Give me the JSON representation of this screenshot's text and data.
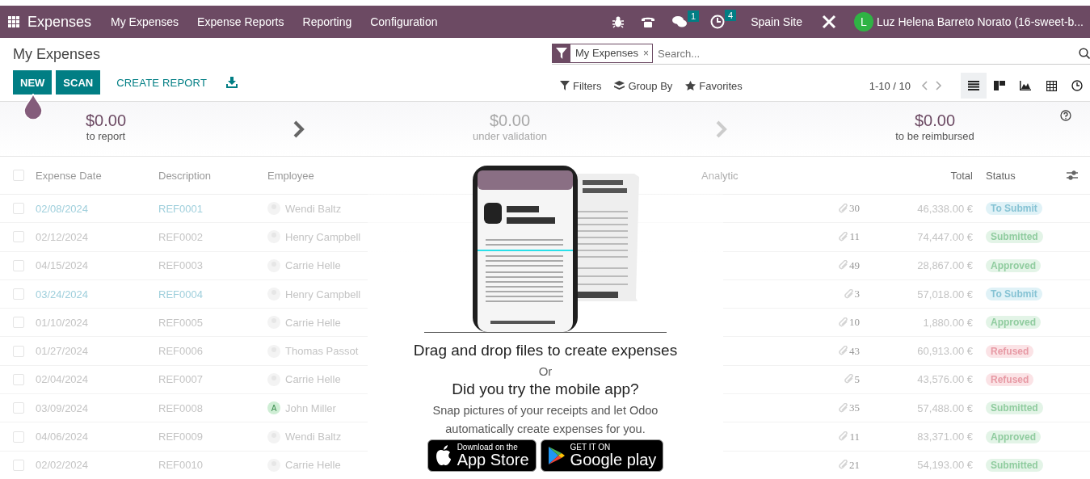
{
  "navbar": {
    "app_name": "Expenses",
    "menu": [
      "My Expenses",
      "Expense Reports",
      "Reporting",
      "Configuration"
    ],
    "messages_count": "1",
    "activities_count": "4",
    "company": "Spain Site",
    "user_initial": "L",
    "user_name": "Luz Helena Barreto Norato (16-sweet-b..."
  },
  "control_panel": {
    "title": "My Expenses",
    "buttons": [
      {
        "label": "NEW",
        "kind": "primary"
      },
      {
        "label": "SCAN",
        "kind": "primary"
      },
      {
        "label": "CREATE REPORT",
        "kind": "link"
      }
    ],
    "search": {
      "facet": "My Expenses",
      "facet_remove": "×",
      "placeholder": "Search..."
    },
    "search_options": [
      {
        "label": "Filters",
        "kind": "filter"
      },
      {
        "label": "Group By",
        "kind": "layers"
      },
      {
        "label": "Favorites",
        "kind": "star"
      }
    ],
    "pager": "1-10 / 10",
    "views": [
      {
        "kind": "list",
        "selected": true
      },
      {
        "kind": "kanban",
        "selected": false
      },
      {
        "kind": "graph",
        "selected": false
      },
      {
        "kind": "pivot",
        "selected": false
      },
      {
        "kind": "activity",
        "selected": false
      }
    ]
  },
  "summary": {
    "stages": [
      {
        "amount": "$0.00",
        "label": "to report",
        "dimmed": false
      },
      {
        "amount": "$0.00",
        "label": "under validation",
        "dimmed": true
      },
      {
        "amount": "$0.00",
        "label": "to be reimbursed",
        "dimmed": false
      }
    ]
  },
  "table": {
    "all_selected": false,
    "columns": [
      "Expense Date",
      "Description",
      "Employee",
      "Analytic",
      "Total",
      "Status"
    ],
    "rows": [
      {
        "selected": false,
        "date": "02/08/2024",
        "description": "REF0001",
        "employee": "Wendi Baltz",
        "avatar": {
          "kind": "image"
        },
        "attachments": "30",
        "total": "46,338.00 €",
        "status": {
          "label": "To Submit",
          "kind": "to_submit"
        }
      },
      {
        "selected": false,
        "date": "02/12/2024",
        "description": "REF0002",
        "employee": "Henry Campbell",
        "avatar": {
          "kind": "image"
        },
        "attachments": "11",
        "total": "74,447.00 €",
        "status": {
          "label": "Submitted",
          "kind": "submitted"
        }
      },
      {
        "selected": false,
        "date": "04/15/2024",
        "description": "REF0003",
        "employee": "Carrie Helle",
        "avatar": {
          "kind": "image"
        },
        "attachments": "49",
        "total": "28,867.00 €",
        "status": {
          "label": "Approved",
          "kind": "approved"
        }
      },
      {
        "selected": false,
        "date": "03/24/2024",
        "description": "REF0004",
        "employee": "Henry Campbell",
        "avatar": {
          "kind": "image"
        },
        "attachments": "3",
        "total": "57,018.00 €",
        "status": {
          "label": "To Submit",
          "kind": "to_submit"
        }
      },
      {
        "selected": false,
        "date": "01/10/2024",
        "description": "REF0005",
        "employee": "Carrie Helle",
        "avatar": {
          "kind": "image"
        },
        "attachments": "10",
        "total": "1,880.00 €",
        "status": {
          "label": "Approved",
          "kind": "approved"
        }
      },
      {
        "selected": false,
        "date": "01/27/2024",
        "description": "REF0006",
        "employee": "Thomas Passot",
        "avatar": {
          "kind": "image"
        },
        "attachments": "43",
        "total": "60,913.00 €",
        "status": {
          "label": "Refused",
          "kind": "refused"
        }
      },
      {
        "selected": false,
        "date": "02/04/2024",
        "description": "REF0007",
        "employee": "Carrie Helle",
        "avatar": {
          "kind": "image"
        },
        "attachments": "5",
        "total": "43,576.00 €",
        "status": {
          "label": "Refused",
          "kind": "refused"
        }
      },
      {
        "selected": false,
        "date": "03/09/2024",
        "description": "REF0008",
        "employee": "John Miller",
        "avatar": {
          "kind": "letter",
          "letter": "A"
        },
        "attachments": "35",
        "total": "57,488.00 €",
        "status": {
          "label": "Submitted",
          "kind": "submitted"
        }
      },
      {
        "selected": false,
        "date": "04/06/2024",
        "description": "REF0009",
        "employee": "Wendi Baltz",
        "avatar": {
          "kind": "image"
        },
        "attachments": "11",
        "total": "83,371.00 €",
        "status": {
          "label": "Approved",
          "kind": "approved"
        }
      },
      {
        "selected": false,
        "date": "02/02/2024",
        "description": "REF0010",
        "employee": "Carrie Helle",
        "avatar": {
          "kind": "image"
        },
        "attachments": "21",
        "total": "54,193.00 €",
        "status": {
          "label": "Submitted",
          "kind": "submitted"
        }
      }
    ]
  },
  "helper": {
    "title": "Drag and drop files to create expenses",
    "or": "Or",
    "subtitle": "Did you try the mobile app?",
    "text": "Snap pictures of your receipts and let Odoo automatically create expenses for you.",
    "stores": [
      {
        "top": "Download on the",
        "bottom": "App Store",
        "kind": "apple"
      },
      {
        "top": "GET IT ON",
        "bottom": "Google play",
        "kind": "google"
      }
    ]
  }
}
